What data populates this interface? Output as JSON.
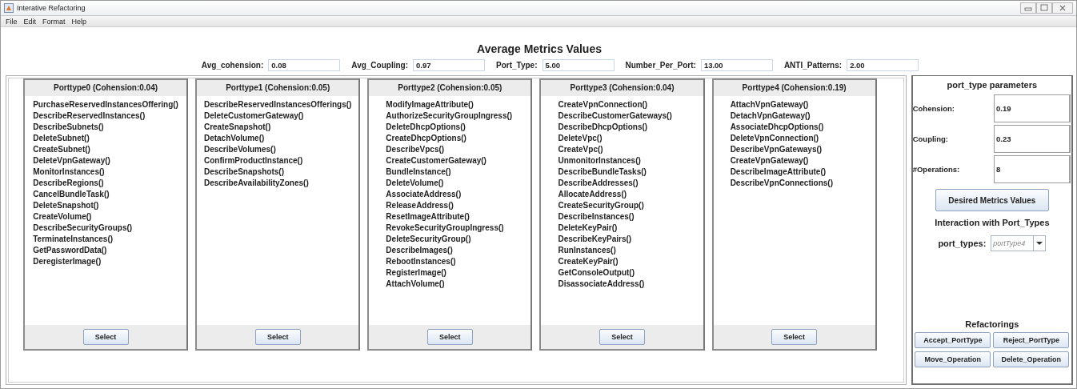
{
  "window": {
    "title": "Interative Refactoring"
  },
  "menu": [
    "File",
    "Edit",
    "Format",
    "Help"
  ],
  "heading": "Average Metrics Values",
  "metrics": [
    {
      "label": "Avg_cohension:",
      "value": "0.08"
    },
    {
      "label": "Avg_Coupling:",
      "value": "0.97"
    },
    {
      "label": "Port_Type:",
      "value": "5.00"
    },
    {
      "label": "Number_Per_Port:",
      "value": "13.00"
    },
    {
      "label": "ANTI_Patterns:",
      "value": "2.00"
    }
  ],
  "port_types": [
    {
      "title": "Porttype0 (Cohension:0.04)",
      "operations": [
        "PurchaseReservedInstancesOffering()",
        "DescribeReservedInstances()",
        "DescribeSubnets()",
        "DeleteSubnet()",
        "CreateSubnet()",
        "DeleteVpnGateway()",
        "MonitorInstances()",
        "DescribeRegions()",
        "CancelBundleTask()",
        "DeleteSnapshot()",
        "CreateVolume()",
        "DescribeSecurityGroups()",
        "TerminateInstances()",
        "GetPasswordData()",
        "DeregisterImage()"
      ],
      "button": "Select"
    },
    {
      "title": "Porttype1 (Cohension:0.05)",
      "operations": [
        "DescribeReservedInstancesOfferings()",
        "DeleteCustomerGateway()",
        "CreateSnapshot()",
        "DetachVolume()",
        "DescribeVolumes()",
        "ConfirmProductInstance()",
        "DescribeSnapshots()",
        "DescribeAvailabilityZones()"
      ],
      "button": "Select"
    },
    {
      "title": "Porttype2 (Cohension:0.05)",
      "operations": [
        "ModifyImageAttribute()",
        "AuthorizeSecurityGroupIngress()",
        "DeleteDhcpOptions()",
        "CreateDhcpOptions()",
        "DescribeVpcs()",
        "CreateCustomerGateway()",
        "BundleInstance()",
        "DeleteVolume()",
        "AssociateAddress()",
        "ReleaseAddress()",
        "ResetImageAttribute()",
        "RevokeSecurityGroupIngress()",
        "DeleteSecurityGroup()",
        "DescribeImages()",
        "RebootInstances()",
        "RegisterImage()",
        "AttachVolume()"
      ],
      "button": "Select"
    },
    {
      "title": "Porttype3 (Cohension:0.04)",
      "operations": [
        "CreateVpnConnection()",
        "DescribeCustomerGateways()",
        "DescribeDhcpOptions()",
        "DeleteVpc()",
        "CreateVpc()",
        "UnmonitorInstances()",
        "DescribeBundleTasks()",
        "DescribeAddresses()",
        "AllocateAddress()",
        "CreateSecurityGroup()",
        "DescribeInstances()",
        "DeleteKeyPair()",
        "DescribeKeyPairs()",
        "RunInstances()",
        "CreateKeyPair()",
        "GetConsoleOutput()",
        "DisassociateAddress()"
      ],
      "button": "Select"
    },
    {
      "title": "Porttype4 (Cohension:0.19)",
      "operations": [
        "AttachVpnGateway()",
        "DetachVpnGateway()",
        "AssociateDhcpOptions()",
        "DeleteVpnConnection()",
        "DescribeVpnGateways()",
        "CreateVpnGateway()",
        "DescribeImageAttribute()",
        "DescribeVpnConnections()"
      ],
      "button": "Select"
    }
  ],
  "parameters": {
    "title": "port_type parameters",
    "fields": [
      {
        "label": "Cohension:",
        "value": "0.19"
      },
      {
        "label": "Coupling:",
        "value": "0.23"
      },
      {
        "label": "#Operations:",
        "value": "8"
      }
    ],
    "desired_button": "Desired Metrics Values",
    "interaction_title": "Interaction with Port_Types",
    "port_types_label": "port_types:",
    "port_types_value": "portType4",
    "refactorings_title": "Refactorings",
    "refactoring_buttons": [
      "Accept_PortType",
      "Reject_PortType",
      "Move_Operation",
      "Delete_Operation"
    ]
  }
}
